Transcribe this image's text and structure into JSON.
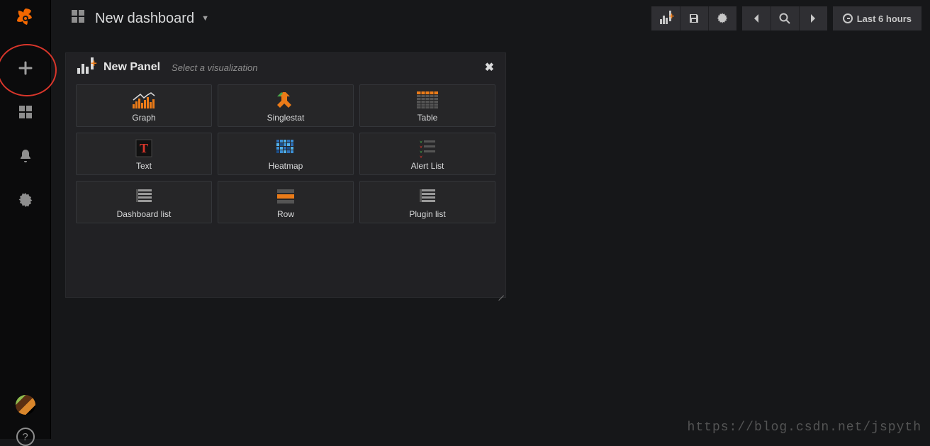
{
  "header": {
    "title": "New dashboard",
    "time_range": "Last 6 hours"
  },
  "sidebar": {
    "items": [
      "create",
      "dashboards",
      "alerting",
      "configuration"
    ]
  },
  "panel": {
    "title": "New Panel",
    "subtitle": "Select a visualization",
    "visualizations": [
      "Graph",
      "Singlestat",
      "Table",
      "Text",
      "Heatmap",
      "Alert List",
      "Dashboard list",
      "Row",
      "Plugin list"
    ]
  },
  "watermark": "https://blog.csdn.net/jspyth"
}
